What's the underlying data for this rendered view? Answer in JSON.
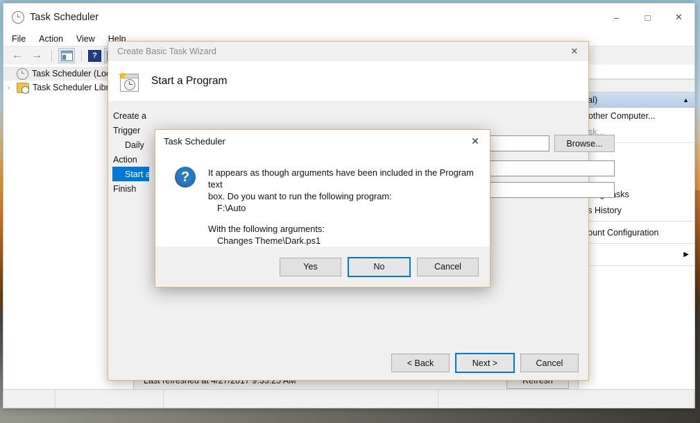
{
  "window": {
    "title": "Task Scheduler",
    "app_icon": "clock-icon",
    "minimize": "–",
    "maximize": "□",
    "close": "✕"
  },
  "menubar": [
    "File",
    "Action",
    "View",
    "Help"
  ],
  "toolbar": {
    "back": "←",
    "forward": "→",
    "show_left_pane": "show-left-pane-icon",
    "help": "?",
    "show_right_pane": "show-right-pane-icon"
  },
  "tree": {
    "items": [
      {
        "label": "Task Scheduler (Local)",
        "icon": "clock-icon",
        "selected": true,
        "expander": ""
      },
      {
        "label": "Task Scheduler Libr",
        "icon": "folder-clock-icon",
        "selected": false,
        "expander": "›"
      }
    ]
  },
  "actions_pane": {
    "header": "cal)",
    "collapse_caret": "▲",
    "items": [
      {
        "label": "nother Computer...",
        "dim": false,
        "caret": ""
      },
      {
        "label": "ask...",
        "dim": true,
        "caret": ""
      },
      {
        "label": "nning Tasks",
        "dim": false,
        "caret": ""
      },
      {
        "label": "ks History",
        "dim": false,
        "caret": ""
      },
      {
        "label": "count Configuration",
        "dim": false,
        "caret": ""
      },
      {
        "label": "",
        "dim": false,
        "caret": "▶"
      }
    ]
  },
  "middle_pane": {
    "refresh_status": "Last refreshed at 4/27/2017 9:33:25 AM",
    "refresh_button": "Refresh"
  },
  "wizard": {
    "title": "Create Basic Task Wizard",
    "close": "✕",
    "heading": "Start a Program",
    "heading_icon": "calendar-clock-star-icon",
    "steps": [
      {
        "label": "Create a Basic Task",
        "sub": false,
        "selected": false
      },
      {
        "label": "Trigger",
        "sub": false,
        "selected": false
      },
      {
        "label": "Daily",
        "sub": true,
        "selected": false
      },
      {
        "label": "Action",
        "sub": false,
        "selected": false
      },
      {
        "label": "Start a Pro",
        "sub": true,
        "selected": true
      },
      {
        "label": "Finish",
        "sub": false,
        "selected": false
      }
    ],
    "browse_button": "Browse...",
    "fields": [
      {
        "name": "program-field",
        "value": ""
      },
      {
        "name": "arguments-field",
        "value": ""
      },
      {
        "name": "startin-field",
        "value": ""
      }
    ],
    "buttons": {
      "back": "< Back",
      "next": "Next >",
      "cancel": "Cancel"
    }
  },
  "dialog": {
    "title": "Task Scheduler",
    "close": "✕",
    "icon": "question-icon",
    "icon_glyph": "?",
    "line1": "It appears as though arguments have been included in the Program text",
    "line2": "box. Do you want to run the following program:",
    "program": "F:\\Auto",
    "line3": "With the following arguments:",
    "arguments": "Changes Theme\\Dark.ps1",
    "buttons": {
      "yes": "Yes",
      "no": "No",
      "cancel": "Cancel"
    }
  },
  "colors": {
    "accent": "#0078d7",
    "selection": "#0078d7",
    "dialog_border": "#d9b679",
    "question_icon": "#2a7ac0"
  }
}
